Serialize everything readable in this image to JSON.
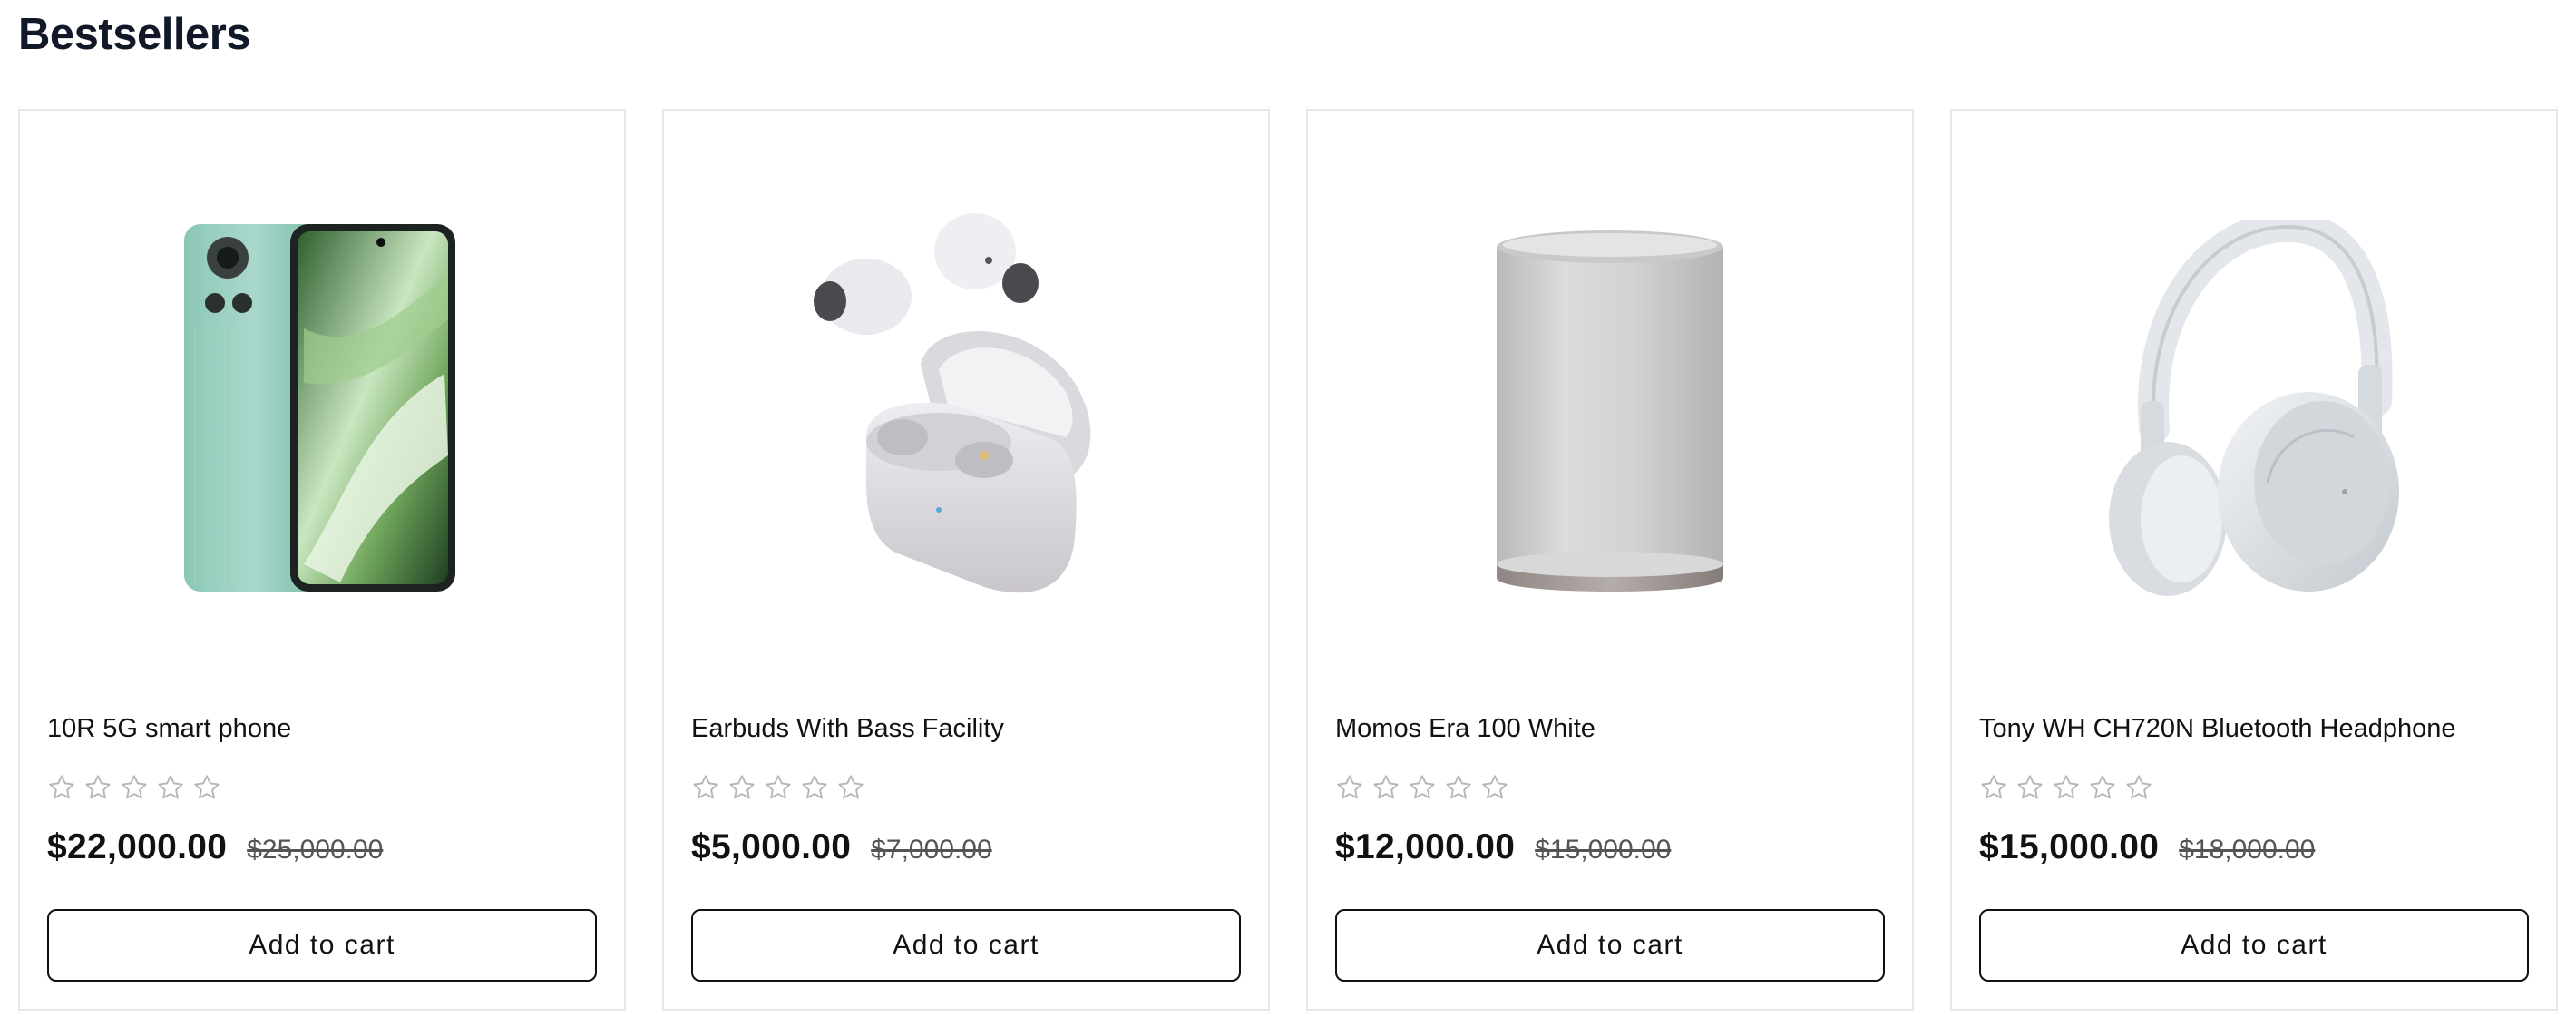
{
  "section": {
    "title": "Bestsellers"
  },
  "products": [
    {
      "name": "10R 5G smart phone",
      "image_icon": "smartphone-image",
      "price": "$22,000.00",
      "old_price": "$25,000.00",
      "rating": {
        "value": 0,
        "max": 5
      },
      "cart_label": "Add to cart"
    },
    {
      "name": "Earbuds With Bass Facility",
      "image_icon": "earbuds-image",
      "price": "$5,000.00",
      "old_price": "$7,000.00",
      "rating": {
        "value": 0,
        "max": 5
      },
      "cart_label": "Add to cart"
    },
    {
      "name": "Momos Era 100 White",
      "image_icon": "speaker-image",
      "price": "$12,000.00",
      "old_price": "$15,000.00",
      "rating": {
        "value": 0,
        "max": 5
      },
      "cart_label": "Add to cart"
    },
    {
      "name": "Tony WH CH720N Bluetooth Headphone",
      "image_icon": "headphones-image",
      "price": "$15,000.00",
      "old_price": "$18,000.00",
      "rating": {
        "value": 0,
        "max": 5
      },
      "cart_label": "Add to cart"
    }
  ],
  "colors": {
    "card_border": "#e5e7eb",
    "star_outline": "#b5b5b5",
    "text": "#111111",
    "old_price": "#555555"
  }
}
